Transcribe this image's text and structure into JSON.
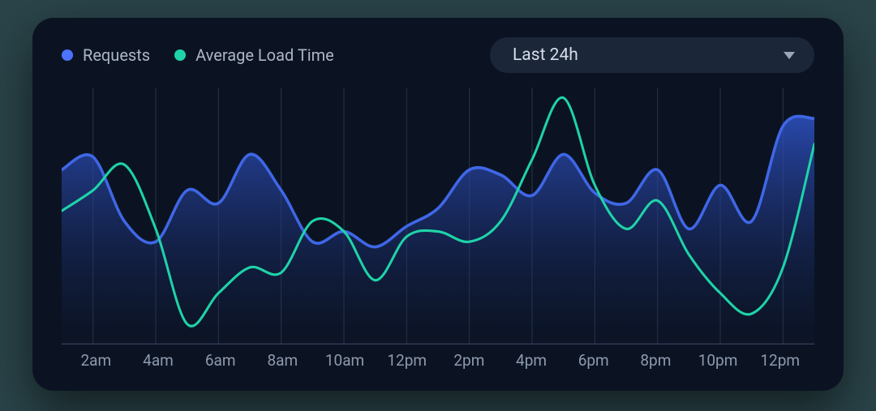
{
  "legend": {
    "series1": "Requests",
    "series2": "Average Load Time"
  },
  "dropdown": {
    "selected": "Last 24h"
  },
  "colors": {
    "requests_stroke": "#3f67e6",
    "requests_fill_top": "rgba(46,82,196,0.85)",
    "requests_fill_bottom": "rgba(20,34,80,0.05)",
    "loadtime_stroke": "#1fd3a7",
    "grid": "#2a3446",
    "baseline": "#33405a"
  },
  "chart_data": {
    "type": "area",
    "title": "",
    "xlabel": "",
    "ylabel": "",
    "ylim": [
      0,
      100
    ],
    "categories": [
      "2am",
      "4am",
      "6am",
      "8am",
      "10am",
      "12pm",
      "2pm",
      "4pm",
      "6pm",
      "8pm",
      "10pm",
      "12pm"
    ],
    "series": [
      {
        "name": "Requests",
        "values": [
          68,
          73,
          48,
          40,
          60,
          55,
          74,
          60,
          40,
          44,
          38,
          46,
          53,
          68,
          66,
          58,
          74,
          59,
          55,
          68,
          45,
          62,
          48,
          85,
          88
        ]
      },
      {
        "name": "Average Load Time",
        "values": [
          52,
          60,
          70,
          45,
          8,
          20,
          30,
          28,
          48,
          44,
          25,
          42,
          44,
          40,
          48,
          72,
          96,
          62,
          45,
          56,
          35,
          20,
          12,
          30,
          78
        ]
      }
    ]
  }
}
